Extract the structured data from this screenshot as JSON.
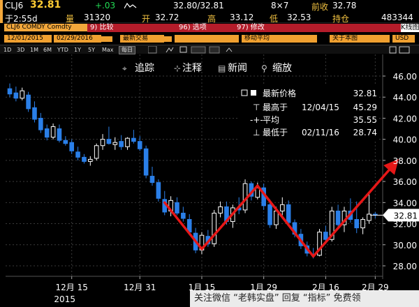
{
  "quote": {
    "ticker": "CLJ6",
    "last": "32.81",
    "change": "+.03",
    "bid_ask": "32.80/32.81",
    "size": "8×7",
    "prev_close_label": "前收",
    "prev_close": "32.78",
    "time": "于2:55d",
    "volume_label": "量",
    "volume": "31320",
    "open_label": "开",
    "open": "32.72",
    "high_label": "高",
    "high": "33.12",
    "low_label": "低",
    "low": "32.53",
    "oi_label": "持仓",
    "oi": "483344"
  },
  "toolbar": {
    "security": "CLJ6 COMDY Comdty",
    "compare": "9) 比较",
    "options": "96) 选项",
    "edit": "97) 修改",
    "chart_label": "K线图"
  },
  "range_row": {
    "start": "12/01/2015",
    "end": "02/29/2016",
    "period": "最新交易",
    "moving_avg": "移动平均",
    "note": "关于本图",
    "currency": "USD"
  },
  "period_buttons": [
    "1D",
    "3D",
    "1M",
    "6M",
    "YTD",
    "1Y",
    "5Y",
    "Max"
  ],
  "period_extra": "每日",
  "tools": [
    "追踪",
    "注释",
    "新闻",
    "缩放"
  ],
  "legend": {
    "title": "最新价格",
    "title_value": "32.81",
    "high_label": "最高于",
    "high_date": "12/04/15",
    "high_value": "45.29",
    "avg_label": "平均",
    "avg_value": "35.55",
    "low_label": "最低于",
    "low_date": "02/11/16",
    "low_value": "28.74"
  },
  "chart_data": {
    "type": "candlestick",
    "ylim": [
      27,
      47
    ],
    "yticks": [
      "46.00",
      "44.00",
      "42.00",
      "40.00",
      "38.00",
      "36.00",
      "34.00",
      "32.00",
      "30.00",
      "28.00"
    ],
    "ytick_values": [
      46,
      44,
      42,
      40,
      38,
      36,
      34,
      32,
      30,
      28
    ],
    "xticks": [
      {
        "label": "12月 15",
        "index": 10
      },
      {
        "label": "12月 31",
        "index": 21
      },
      {
        "label": "1月 15",
        "index": 31
      },
      {
        "label": "1月 29",
        "index": 41
      },
      {
        "label": "2月 16",
        "index": 51
      },
      {
        "label": "2月 29",
        "index": 59
      }
    ],
    "year_label": "2015",
    "last_price_tag": "32.81",
    "candles": [
      {
        "o": 44.8,
        "h": 45.3,
        "l": 44.0,
        "c": 44.3
      },
      {
        "o": 44.4,
        "h": 45.0,
        "l": 43.6,
        "c": 43.9
      },
      {
        "o": 43.9,
        "h": 44.9,
        "l": 43.7,
        "c": 44.6
      },
      {
        "o": 44.2,
        "h": 44.5,
        "l": 42.6,
        "c": 42.9
      },
      {
        "o": 43.0,
        "h": 43.6,
        "l": 41.6,
        "c": 41.9
      },
      {
        "o": 42.0,
        "h": 42.5,
        "l": 40.6,
        "c": 40.9
      },
      {
        "o": 41.0,
        "h": 41.4,
        "l": 39.9,
        "c": 40.2
      },
      {
        "o": 40.2,
        "h": 41.5,
        "l": 40.0,
        "c": 41.2
      },
      {
        "o": 41.0,
        "h": 41.4,
        "l": 39.7,
        "c": 39.9
      },
      {
        "o": 39.9,
        "h": 40.3,
        "l": 39.4,
        "c": 39.6
      },
      {
        "o": 39.7,
        "h": 40.0,
        "l": 38.6,
        "c": 38.9
      },
      {
        "o": 38.8,
        "h": 39.3,
        "l": 38.0,
        "c": 38.3
      },
      {
        "o": 38.3,
        "h": 38.6,
        "l": 37.7,
        "c": 37.9
      },
      {
        "o": 37.9,
        "h": 38.4,
        "l": 37.5,
        "c": 38.1
      },
      {
        "o": 38.2,
        "h": 39.6,
        "l": 38.0,
        "c": 39.4
      },
      {
        "o": 39.4,
        "h": 40.5,
        "l": 39.0,
        "c": 40.0
      },
      {
        "o": 40.0,
        "h": 41.2,
        "l": 39.5,
        "c": 39.6
      },
      {
        "o": 39.5,
        "h": 40.2,
        "l": 39.0,
        "c": 39.7
      },
      {
        "o": 39.8,
        "h": 40.4,
        "l": 39.0,
        "c": 39.3
      },
      {
        "o": 39.3,
        "h": 40.2,
        "l": 39.0,
        "c": 40.1
      },
      {
        "o": 40.1,
        "h": 40.9,
        "l": 39.6,
        "c": 39.8
      },
      {
        "o": 39.8,
        "h": 40.3,
        "l": 38.9,
        "c": 39.1
      },
      {
        "o": 39.1,
        "h": 39.4,
        "l": 36.3,
        "c": 36.6
      },
      {
        "o": 36.5,
        "h": 37.4,
        "l": 35.6,
        "c": 35.9
      },
      {
        "o": 35.9,
        "h": 36.2,
        "l": 34.1,
        "c": 34.4
      },
      {
        "o": 34.3,
        "h": 35.1,
        "l": 32.8,
        "c": 33.1
      },
      {
        "o": 33.2,
        "h": 34.6,
        "l": 32.7,
        "c": 34.2
      },
      {
        "o": 34.0,
        "h": 34.5,
        "l": 32.8,
        "c": 33.0
      },
      {
        "o": 33.0,
        "h": 33.6,
        "l": 32.2,
        "c": 32.5
      },
      {
        "o": 32.4,
        "h": 32.9,
        "l": 30.9,
        "c": 31.2
      },
      {
        "o": 31.1,
        "h": 31.6,
        "l": 29.2,
        "c": 29.5
      },
      {
        "o": 29.5,
        "h": 31.2,
        "l": 29.1,
        "c": 30.9
      },
      {
        "o": 30.8,
        "h": 31.4,
        "l": 29.8,
        "c": 30.1
      },
      {
        "o": 30.1,
        "h": 33.3,
        "l": 29.8,
        "c": 33.0
      },
      {
        "o": 33.0,
        "h": 34.1,
        "l": 32.6,
        "c": 33.6
      },
      {
        "o": 33.6,
        "h": 34.1,
        "l": 31.9,
        "c": 32.2
      },
      {
        "o": 32.2,
        "h": 33.8,
        "l": 31.6,
        "c": 33.5
      },
      {
        "o": 33.5,
        "h": 34.5,
        "l": 32.9,
        "c": 33.3
      },
      {
        "o": 33.3,
        "h": 36.2,
        "l": 33.0,
        "c": 35.8
      },
      {
        "o": 35.8,
        "h": 36.0,
        "l": 34.2,
        "c": 34.6
      },
      {
        "o": 34.5,
        "h": 35.9,
        "l": 34.3,
        "c": 35.4
      },
      {
        "o": 35.4,
        "h": 35.8,
        "l": 33.3,
        "c": 33.7
      },
      {
        "o": 33.8,
        "h": 34.3,
        "l": 31.6,
        "c": 31.9
      },
      {
        "o": 31.9,
        "h": 33.6,
        "l": 31.5,
        "c": 33.2
      },
      {
        "o": 33.2,
        "h": 34.5,
        "l": 32.8,
        "c": 33.8
      },
      {
        "o": 33.8,
        "h": 34.2,
        "l": 31.8,
        "c": 32.1
      },
      {
        "o": 32.1,
        "h": 32.4,
        "l": 30.7,
        "c": 31.0
      },
      {
        "o": 31.0,
        "h": 31.5,
        "l": 29.6,
        "c": 29.9
      },
      {
        "o": 29.9,
        "h": 30.3,
        "l": 28.9,
        "c": 29.2
      },
      {
        "o": 29.1,
        "h": 29.7,
        "l": 28.7,
        "c": 29.0
      },
      {
        "o": 29.0,
        "h": 31.5,
        "l": 28.9,
        "c": 31.2
      },
      {
        "o": 31.2,
        "h": 31.8,
        "l": 30.2,
        "c": 30.5
      },
      {
        "o": 30.5,
        "h": 33.6,
        "l": 30.3,
        "c": 33.2
      },
      {
        "o": 33.2,
        "h": 33.8,
        "l": 31.5,
        "c": 31.9
      },
      {
        "o": 31.9,
        "h": 33.6,
        "l": 31.2,
        "c": 33.2
      },
      {
        "o": 33.2,
        "h": 34.4,
        "l": 32.1,
        "c": 32.4
      },
      {
        "o": 32.4,
        "h": 34.1,
        "l": 31.1,
        "c": 31.6
      },
      {
        "o": 31.6,
        "h": 32.6,
        "l": 31.0,
        "c": 32.4
      },
      {
        "o": 32.3,
        "h": 34.8,
        "l": 32.0,
        "c": 32.9
      },
      {
        "o": 32.9,
        "h": 33.1,
        "l": 32.5,
        "c": 32.8
      }
    ],
    "annotation_arrows": [
      {
        "from": {
          "index": 25,
          "value": 34.0
        },
        "to": {
          "index": 31,
          "value": 29.6
        },
        "arrow": false
      },
      {
        "from": {
          "index": 31,
          "value": 29.6
        },
        "to": {
          "index": 40,
          "value": 35.6
        },
        "arrow": false
      },
      {
        "from": {
          "index": 40,
          "value": 35.6
        },
        "to": {
          "index": 49,
          "value": 28.9
        },
        "arrow": false
      },
      {
        "from": {
          "index": 49,
          "value": 28.9
        },
        "to": {
          "index": 62,
          "value": 37.6
        },
        "arrow": true
      }
    ],
    "colors": {
      "up": "#ffffff",
      "down": "#2a7fe8",
      "arrow": "#e61717",
      "grid": "#3a3a3a"
    }
  },
  "watermark": "关注微信 “老韩实盘” 回复 “指标” 免费领"
}
